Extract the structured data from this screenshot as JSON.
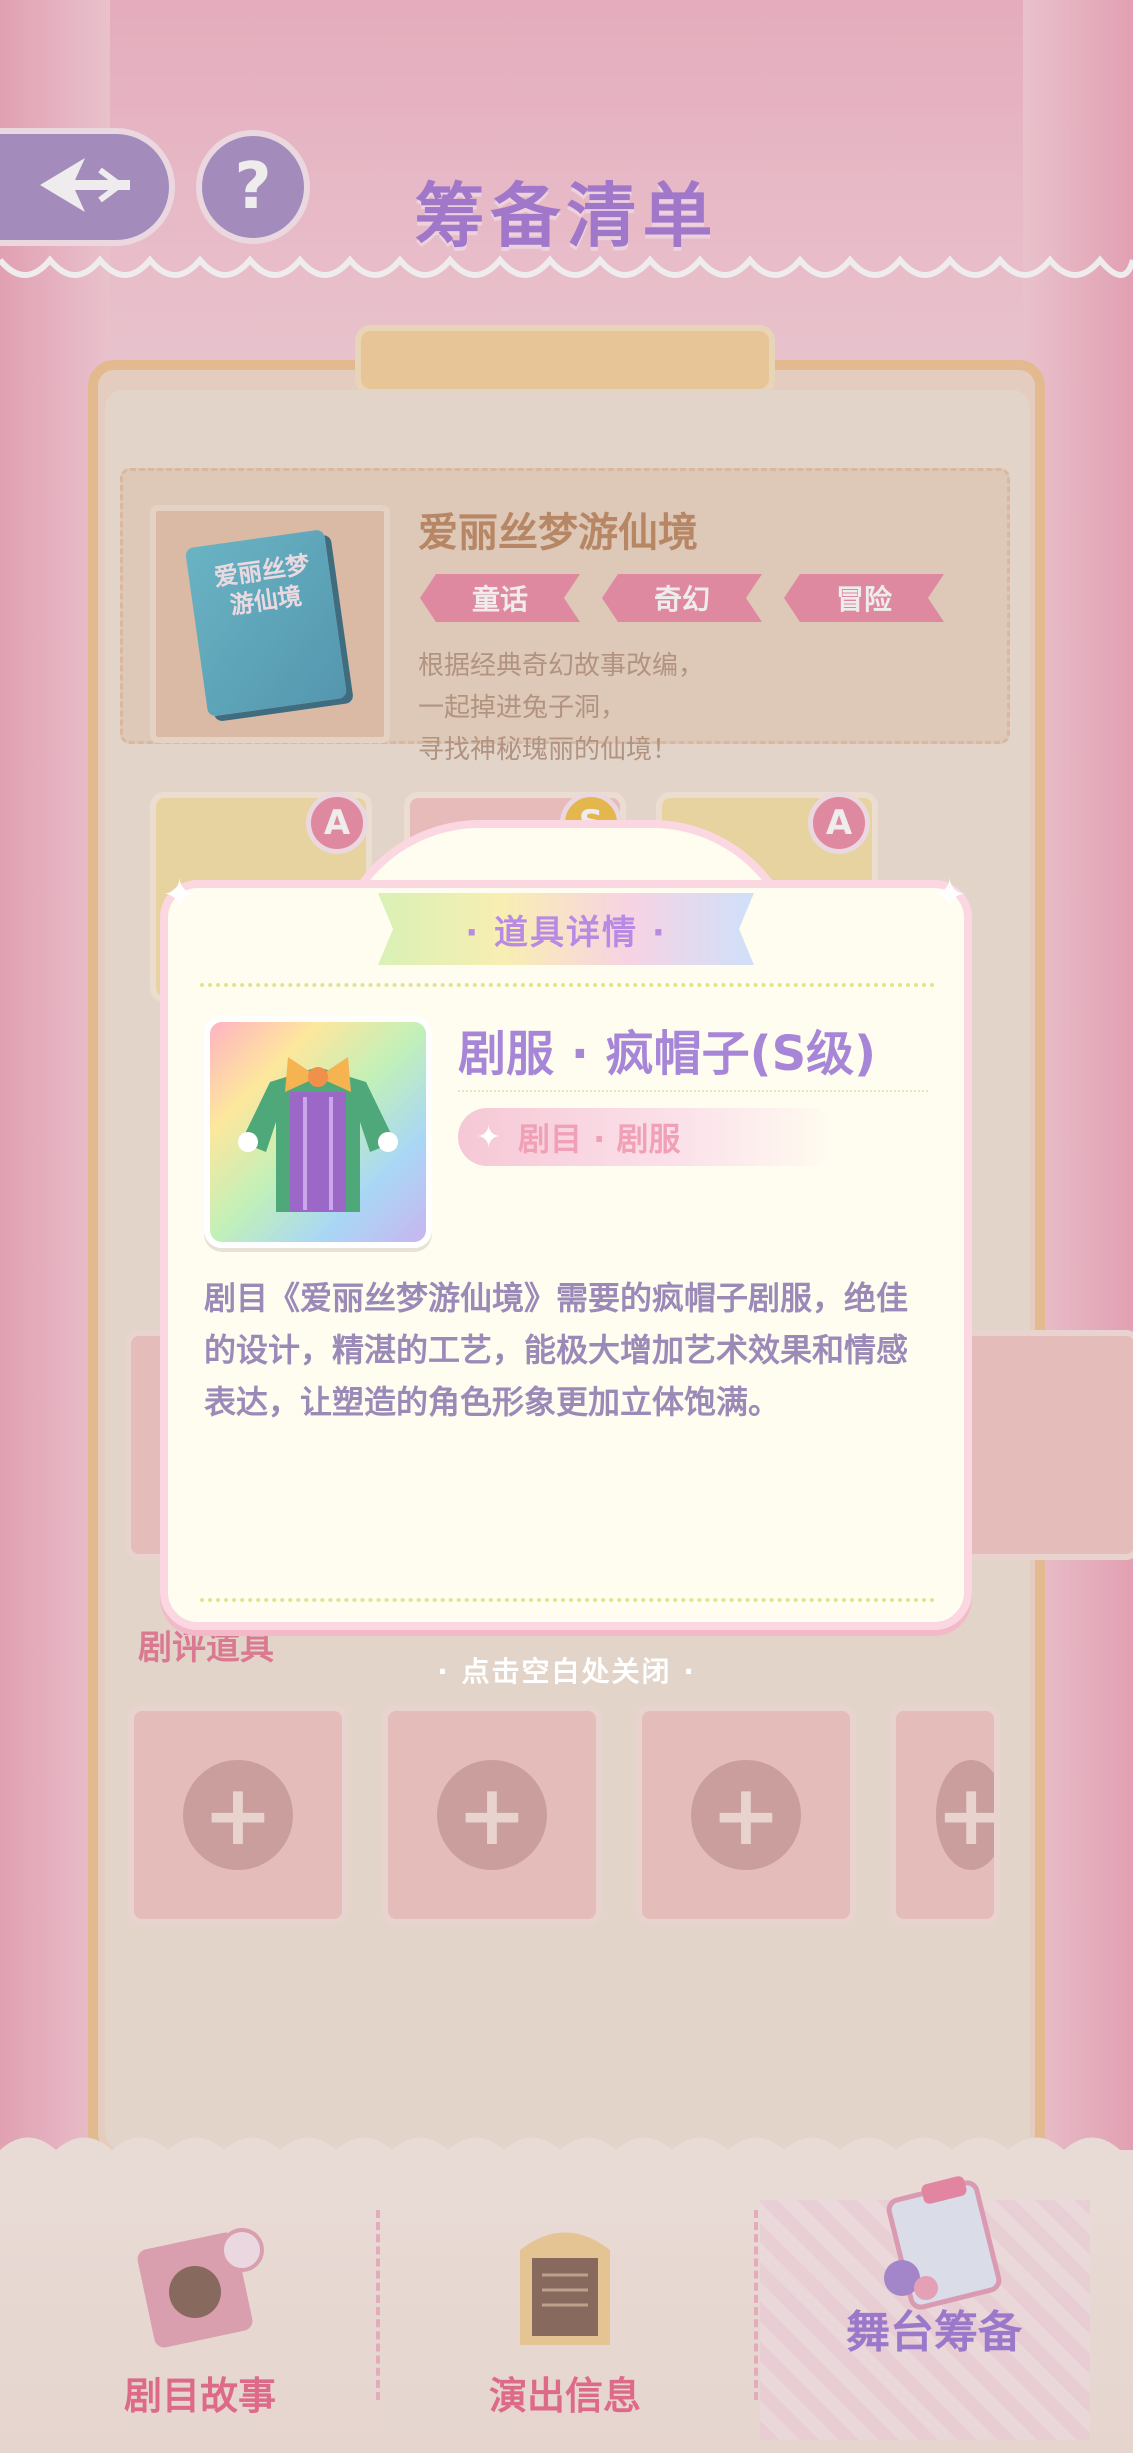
{
  "header": {
    "title": "筹备清单",
    "back_icon": "back-arrow-icon",
    "help_label": "?"
  },
  "story": {
    "book_title": "爱丽丝梦游仙境",
    "title": "爱丽丝梦游仙境",
    "tags": [
      "童话",
      "奇幻",
      "冒险"
    ],
    "description_lines": [
      "根据经典奇幻故事改编，",
      "一起掉进兔子洞，",
      "寻找神秘瑰丽的仙境！"
    ],
    "character_badges": [
      "A",
      "S",
      "A"
    ]
  },
  "sections": {
    "review_props_label": "剧评道具"
  },
  "modal": {
    "header": "· 道具详情 ·",
    "item_name": "剧服 · 疯帽子(S级)",
    "item_category": "剧目 · 剧服",
    "description": "剧目《爱丽丝梦游仙境》需要的疯帽子剧服，绝佳的设计，精湛的工艺，能极大增加艺术效果和情感表达，让塑造的角色形象更加立体饱满。",
    "close_hint": "· 点击空白处关闭 ·"
  },
  "bottom_nav": {
    "items": [
      {
        "label": "剧目故事",
        "icon": "story-book-icon",
        "active": false
      },
      {
        "label": "演出信息",
        "icon": "poster-board-icon",
        "active": false
      },
      {
        "label": "舞台筹备",
        "icon": "clipboard-icon",
        "active": true
      }
    ]
  },
  "colors": {
    "accent_purple": "#a786d8",
    "accent_pink": "#ec8fa7",
    "modal_bg": "#fffdf0"
  }
}
